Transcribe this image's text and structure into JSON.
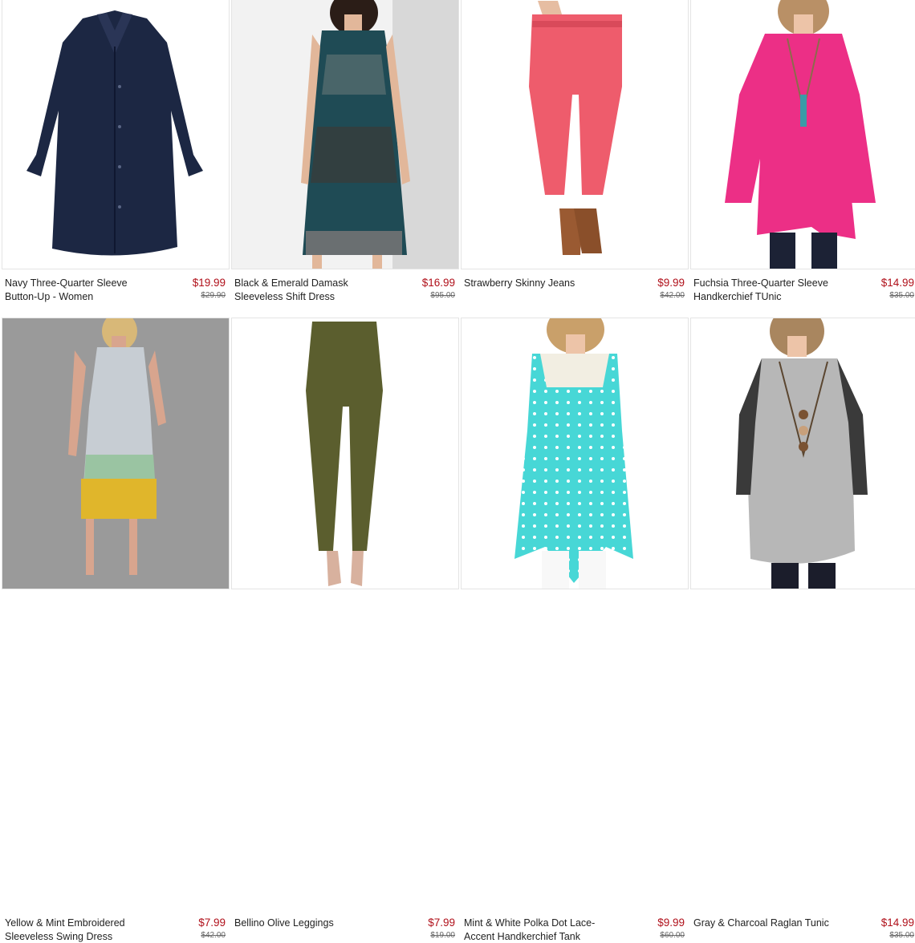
{
  "products": [
    {
      "title": "Navy Three-Quarter Sleeve Button-Up - Women",
      "price": "$19.99",
      "original_price": "$29.90"
    },
    {
      "title": "Black & Emerald Damask Sleeveless Shift Dress",
      "price": "$16.99",
      "original_price": "$95.00"
    },
    {
      "title": "Strawberry Skinny Jeans",
      "price": "$9.99",
      "original_price": "$42.00"
    },
    {
      "title": "Fuchsia Three-Quarter Sleeve Handkerchief TUnic",
      "price": "$14.99",
      "original_price": "$35.00"
    },
    {
      "title": "Yellow & Mint Embroidered Sleeveless Swing Dress",
      "price": "$7.99",
      "original_price": "$42.00"
    },
    {
      "title": "Bellino Olive Leggings",
      "price": "$7.99",
      "original_price": "$19.00"
    },
    {
      "title": "Mint & White Polka Dot Lace-Accent Handkerchief Tank",
      "price": "$9.99",
      "original_price": "$60.00"
    },
    {
      "title": "Gray & Charcoal Raglan Tunic",
      "price": "$14.99",
      "original_price": "$35.00"
    }
  ],
  "colors": {
    "price": "#b0101a",
    "text": "#222222",
    "strike": "#666666"
  }
}
